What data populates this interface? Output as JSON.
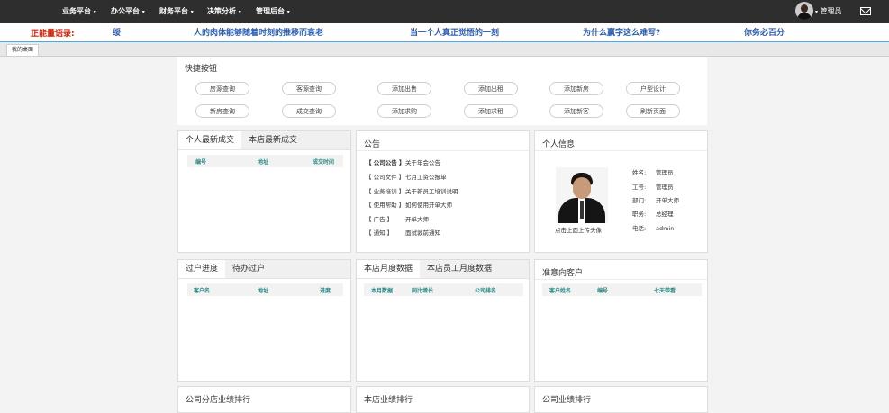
{
  "topnav": {
    "items": [
      {
        "label": "业务平台"
      },
      {
        "label": "办公平台"
      },
      {
        "label": "财务平台"
      },
      {
        "label": "决策分析"
      },
      {
        "label": "管理后台"
      }
    ],
    "caret": "▾",
    "user_label": "管理员"
  },
  "ticker": {
    "label": "正能量语录:",
    "items": [
      "绥",
      "人的肉体能够随着时刻的推移而衰老",
      "当一个人真正觉悟的一刻",
      "为什么赢字这么难写?",
      "你务必百分"
    ]
  },
  "tabs": [
    {
      "label": "我的桌面"
    }
  ],
  "quick": {
    "title": "快捷按钮",
    "buttons": [
      "房源查询",
      "客源查询",
      "添加出售",
      "添加出租",
      "添加新房",
      "户型设计",
      "新房查询",
      "成交查询",
      "添加求购",
      "添加求租",
      "添加新客",
      "刷新页面"
    ]
  },
  "deals": {
    "tabs": [
      "个人最新成交",
      "本店最新成交"
    ],
    "columns": [
      "编号",
      "地址",
      "成交时间"
    ]
  },
  "notice": {
    "title": "公告",
    "items": [
      {
        "tag": "【 公司公告 】",
        "text": "关于年会公告"
      },
      {
        "tag": "【 公司文件 】",
        "text": "七月工资公报单"
      },
      {
        "tag": "【 业务培训 】",
        "text": "关于新员工培训说明"
      },
      {
        "tag": "【 使用帮助 】",
        "text": "如何使用开单大师"
      },
      {
        "tag": "【 广告 】",
        "text": "开单大师"
      },
      {
        "tag": "【 通知 】",
        "text": "面试敦前通知"
      }
    ]
  },
  "profile": {
    "title": "个人信息",
    "upload_hint": "点击上面上传头像",
    "fields": [
      {
        "key": "姓名:",
        "value": "管理员"
      },
      {
        "key": "工号:",
        "value": "管理员"
      },
      {
        "key": "部门:",
        "value": "开单大师"
      },
      {
        "key": "职务:",
        "value": "总经理"
      },
      {
        "key": "电话:",
        "value": "admin"
      }
    ]
  },
  "transfer": {
    "tabs": [
      "过户进度",
      "待办过户"
    ],
    "columns": [
      "客户名",
      "地址",
      "进度"
    ]
  },
  "monthly": {
    "tabs": [
      "本店月度数据",
      "本店员工月度数据"
    ],
    "columns": [
      "本月数据",
      "同比增长",
      "公司排名"
    ]
  },
  "prospects": {
    "title": "准意向客户",
    "columns": [
      "客户姓名",
      "编号",
      "七天带看"
    ]
  },
  "bottom_panels": [
    {
      "title": "公司分店业绩排行"
    },
    {
      "title": "本店业绩排行"
    },
    {
      "title": "公司业绩排行"
    }
  ]
}
